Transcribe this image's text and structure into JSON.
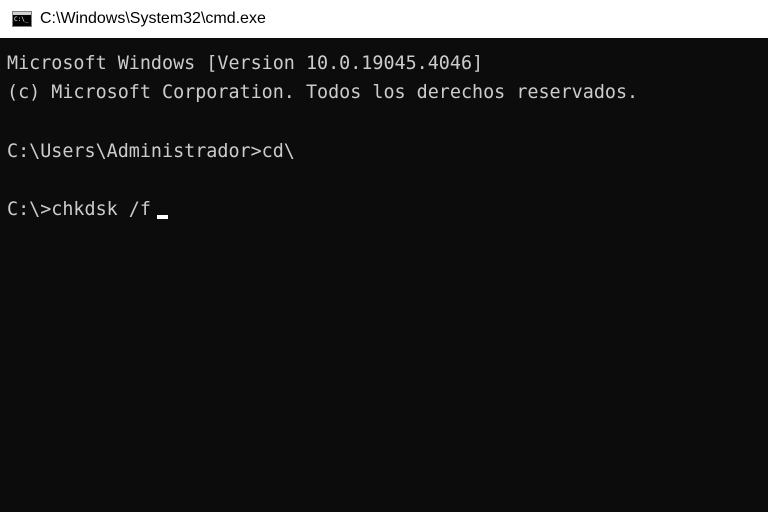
{
  "window": {
    "title": "C:\\Windows\\System32\\cmd.exe",
    "icon": "cmd-console-icon",
    "icon_text": "C:\\_"
  },
  "console": {
    "lines": [
      "Microsoft Windows [Version 10.0.19045.4046]",
      "(c) Microsoft Corporation. Todos los derechos reservados.",
      "",
      "C:\\Users\\Administrador>cd\\",
      "",
      "C:\\>chkdsk /f"
    ],
    "cursor": "block-underline"
  },
  "colors": {
    "background": "#0c0c0c",
    "foreground": "#cccccc",
    "titlebar": "#ffffff"
  }
}
